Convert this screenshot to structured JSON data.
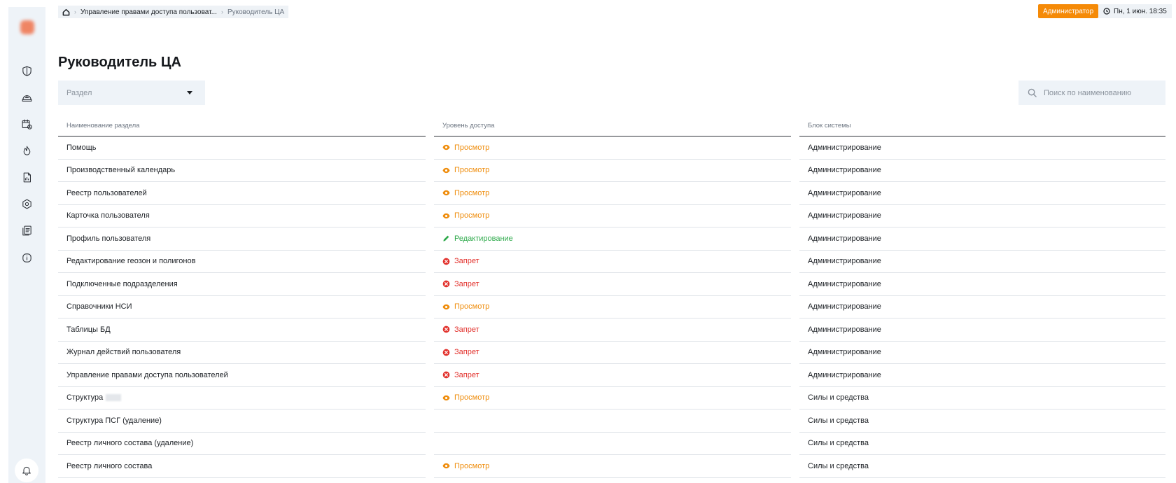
{
  "breadcrumb": {
    "items": [
      "Управление правами доступа пользоват...",
      "Руководитель ЦА"
    ]
  },
  "header": {
    "role": "Администратор",
    "datetime": "Пн, 1 июн. 18:35"
  },
  "page": {
    "title": "Руководитель ЦА"
  },
  "filters": {
    "section_placeholder": "Раздел",
    "search_placeholder": "Поиск по наименованию"
  },
  "table": {
    "columns": [
      "Наименование раздела",
      "Уровень доступа",
      "Блок системы"
    ],
    "rows": [
      {
        "name": "Помощь",
        "access": "Просмотр",
        "block": "Администрирование"
      },
      {
        "name": "Производственный календарь",
        "access": "Просмотр",
        "block": "Администрирование"
      },
      {
        "name": "Реестр пользователей",
        "access": "Просмотр",
        "block": "Администрирование"
      },
      {
        "name": "Карточка пользователя",
        "access": "Просмотр",
        "block": "Администрирование"
      },
      {
        "name": "Профиль пользователя",
        "access": "Редактирование",
        "block": "Администрирование"
      },
      {
        "name": "Редактирование геозон и полигонов",
        "access": "Запрет",
        "block": "Администрирование"
      },
      {
        "name": "Подключенные подразделения",
        "access": "Запрет",
        "block": "Администрирование"
      },
      {
        "name": "Справочники НСИ",
        "access": "Просмотр",
        "block": "Администрирование"
      },
      {
        "name": "Таблицы БД",
        "access": "Запрет",
        "block": "Администрирование"
      },
      {
        "name": "Журнал действий пользователя",
        "access": "Запрет",
        "block": "Администрирование"
      },
      {
        "name": "Управление правами доступа пользователей",
        "access": "Запрет",
        "block": "Администрирование"
      },
      {
        "name": "Структура",
        "access": "Просмотр",
        "block": "Силы и средства"
      },
      {
        "name": "Структура ПСГ (удаление)",
        "access": "",
        "block": "Силы и средства"
      },
      {
        "name": "Реестр личного состава (удаление)",
        "access": "",
        "block": "Силы и средства"
      },
      {
        "name": "Реестр личного состава",
        "access": "Просмотр",
        "block": "Силы и средства"
      }
    ]
  },
  "sidebar": {
    "icons": [
      "shield-icon",
      "helmet-icon",
      "calendar-clock-icon",
      "flame-icon",
      "document-chart-icon",
      "hexagon-gear-icon",
      "journal-icon",
      "info-icon"
    ],
    "bottom_icon": "bell-icon"
  },
  "colors": {
    "accent": "#f58a07",
    "view": "#ef8d0d",
    "edit": "#2eaa4b",
    "deny": "#e2322d",
    "sidebar_bg": "#eef3f8"
  }
}
